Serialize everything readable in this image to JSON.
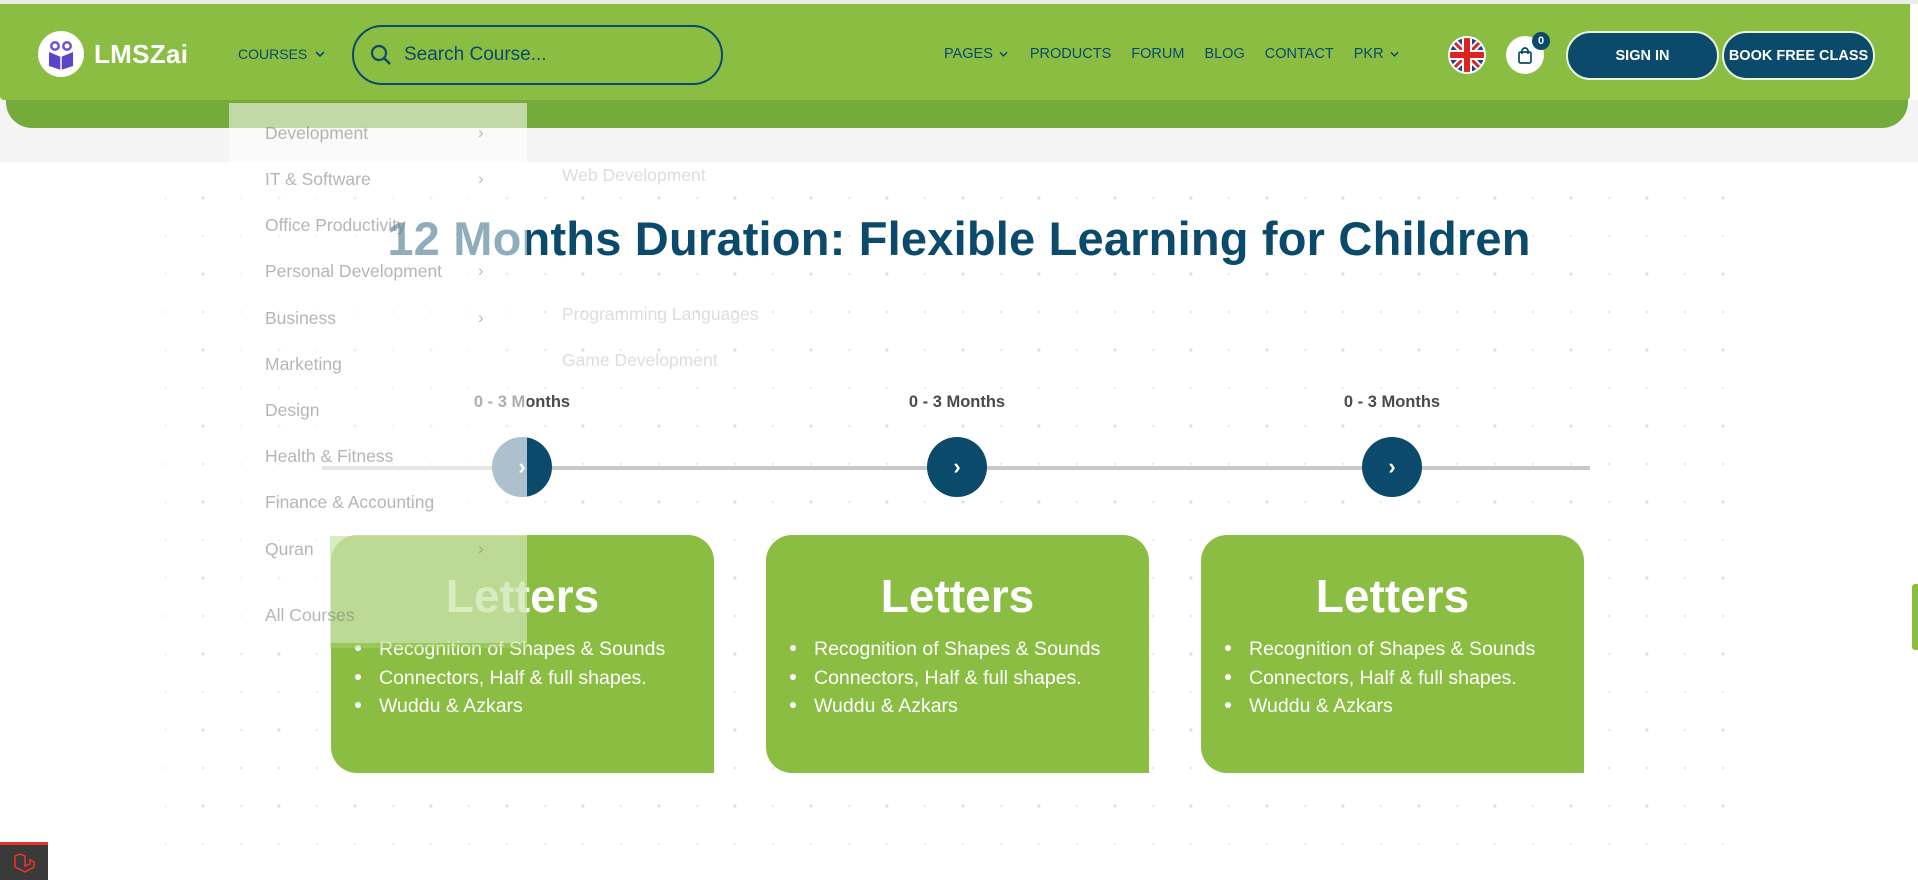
{
  "header": {
    "logo_text": "LMSZai",
    "courses_label": "COURSES",
    "search_placeholder": "Search Course...",
    "nav": [
      "PAGES",
      "PRODUCTS",
      "FORUM",
      "BLOG",
      "CONTACT",
      "PKR"
    ],
    "cart_count": "0",
    "sign_in": "SIGN IN",
    "book_free_class": "BOOK FREE CLASS"
  },
  "dropdown": {
    "categories": [
      "Development",
      "IT & Software",
      "Office Productivity",
      "Personal Development",
      "Business",
      "Marketing",
      "Design",
      "Health & Fitness",
      "Finance & Accounting",
      "Quran"
    ],
    "all_courses": "All Courses",
    "subcategories": [
      "Web Development",
      "Programming Languages",
      "Game Development"
    ]
  },
  "section": {
    "title": "12 Months Duration: Flexible Learning for Children",
    "steps": [
      {
        "duration": "0 - 3 Months",
        "title": "Letters",
        "points": [
          "Recognition of Shapes & Sounds",
          "Connectors, Half & full shapes.",
          "Wuddu & Azkars"
        ]
      },
      {
        "duration": "0 - 3 Months",
        "title": "Letters",
        "points": [
          "Recognition of Shapes & Sounds",
          "Connectors, Half & full shapes.",
          "Wuddu & Azkars"
        ]
      },
      {
        "duration": "0 - 3 Months",
        "title": "Letters",
        "points": [
          "Recognition of Shapes & Sounds",
          "Connectors, Half & full shapes.",
          "Wuddu & Azkars"
        ]
      }
    ]
  },
  "colors": {
    "brand_green": "#8abd42",
    "navy": "#0b4a6b",
    "accent_red": "#e2352b"
  },
  "icons": {
    "logo": "owl-book-icon",
    "search": "search-icon",
    "flag": "uk-flag-icon",
    "cart": "shopping-bag-icon",
    "step": "chevron-right-icon",
    "debug": "laravel-icon"
  }
}
